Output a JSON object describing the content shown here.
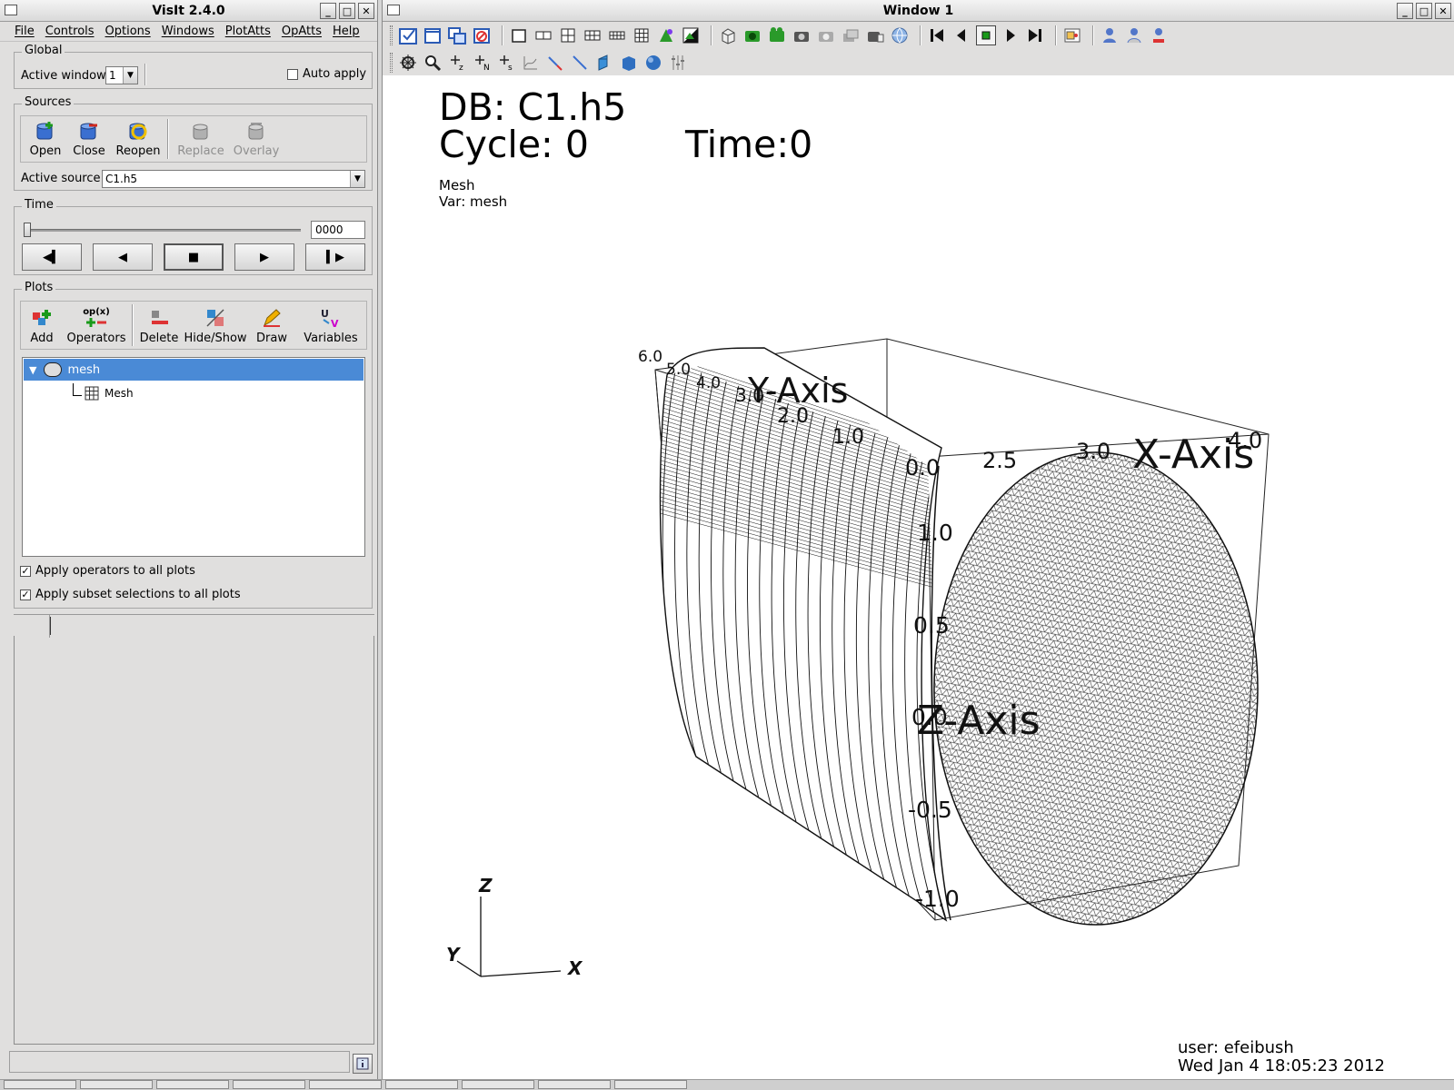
{
  "main_window": {
    "title": "VisIt 2.4.0",
    "menu": [
      "File",
      "Controls",
      "Options",
      "Windows",
      "PlotAtts",
      "OpAtts",
      "Help"
    ],
    "global": {
      "title": "Global",
      "active_window_label": "Active window",
      "active_window_value": "1",
      "auto_apply_label": "Auto apply"
    },
    "sources": {
      "title": "Sources",
      "buttons": {
        "open": "Open",
        "close": "Close",
        "reopen": "Reopen",
        "replace": "Replace",
        "overlay": "Overlay"
      },
      "active_source_label": "Active source",
      "active_source_value": "C1.h5"
    },
    "time": {
      "title": "Time",
      "frame_value": "0000",
      "slider_fraction": 0.0
    },
    "plots": {
      "title": "Plots",
      "buttons": {
        "add": "Add",
        "operators": "Operators",
        "operators_icon_text": "op(x)",
        "delete": "Delete",
        "hide_show": "Hide/Show",
        "draw": "Draw",
        "variables": "Variables"
      },
      "tree": [
        {
          "name": "mesh",
          "children": [
            "Mesh"
          ]
        }
      ],
      "apply_operators_label": "Apply operators to all plots",
      "apply_subset_label": "Apply subset selections to all plots"
    }
  },
  "viz_window": {
    "title": "Window 1",
    "annotations": {
      "db": "DB: C1.h5",
      "cycle": "Cycle: 0",
      "time": "Time:0",
      "plot_name": "Mesh",
      "var": "Var: mesh",
      "user": "user: efeibush",
      "date": "Wed Jan  4 18:05:23 2012"
    },
    "axes": {
      "x_title": "X-Axis",
      "y_title": "Y-Axis",
      "z_title": "Z-Axis",
      "triad": {
        "x": "X",
        "y": "Y",
        "z": "Z"
      },
      "x_ticks": [
        "0.0",
        "2.5",
        "3.0",
        "4.0"
      ],
      "y_ticks": [
        "6.0",
        "5.0",
        "4.0",
        "3.0",
        "2.0",
        "1.0"
      ],
      "z_ticks": [
        "1.0",
        "0.5",
        "0.0",
        "-0.5",
        "-1.0"
      ]
    }
  }
}
